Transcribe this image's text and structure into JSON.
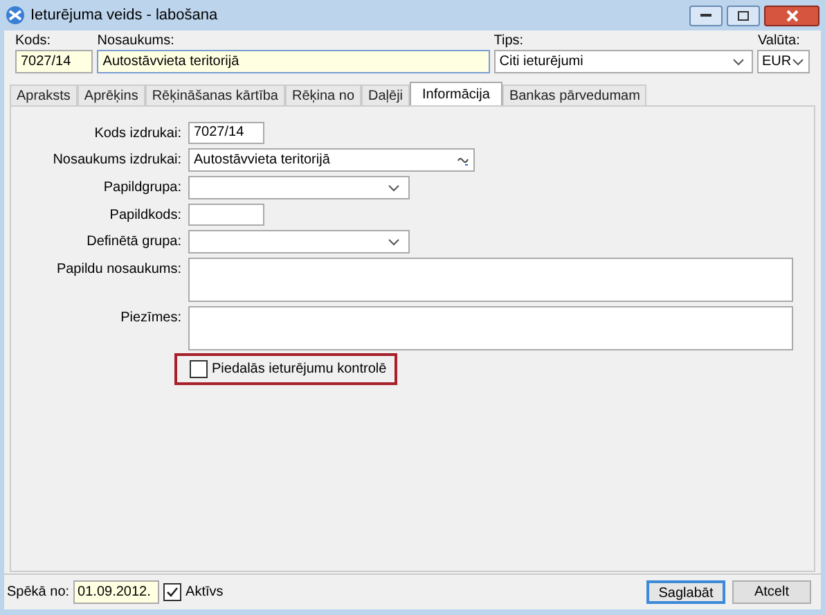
{
  "window": {
    "title": "Ieturējuma veids - labošana"
  },
  "header": {
    "kods": {
      "label": "Kods:",
      "value": "7027/14"
    },
    "nosaukums": {
      "label": "Nosaukums:",
      "value": "Autostāvvieta teritorijā"
    },
    "tips": {
      "label": "Tips:",
      "value": "Citi ieturējumi"
    },
    "valuta": {
      "label": "Valūta:",
      "value": "EUR"
    }
  },
  "tabs": [
    {
      "label": "Apraksts",
      "selected": false
    },
    {
      "label": "Aprēķins",
      "selected": false
    },
    {
      "label": "Rēķināšanas kārtība",
      "selected": false
    },
    {
      "label": "Rēķina no",
      "selected": false
    },
    {
      "label": "Daļēji",
      "selected": false
    },
    {
      "label": "Informācija",
      "selected": true
    },
    {
      "label": "Bankas pārvedumam",
      "selected": false
    }
  ],
  "fields": [
    {
      "kind": "short",
      "label": "Kods izdrukai:",
      "value": "7027/14"
    },
    {
      "kind": "special",
      "label": "Nosaukums izdrukai:",
      "value": "Autostāvvieta teritorijā"
    },
    {
      "kind": "dropdown",
      "label": "Papildgrupa:"
    },
    {
      "kind": "short",
      "label": "Papildkods:"
    },
    {
      "kind": "dropdown",
      "label": "Definētā grupa:"
    },
    {
      "kind": "memo",
      "label": "Papildu nosaukums:"
    },
    {
      "kind": "memo",
      "label": "Piezīmes:"
    }
  ],
  "control_checkbox": {
    "label": "Piedalās ieturējumu kontrolē",
    "checked": false
  },
  "footer": {
    "valid_from": {
      "label": "Spēkā no:",
      "value": "01.09.2012."
    },
    "active": {
      "label": "Aktīvs",
      "checked": true
    },
    "buttons": [
      "Saglabāt",
      "Atcelt"
    ]
  }
}
